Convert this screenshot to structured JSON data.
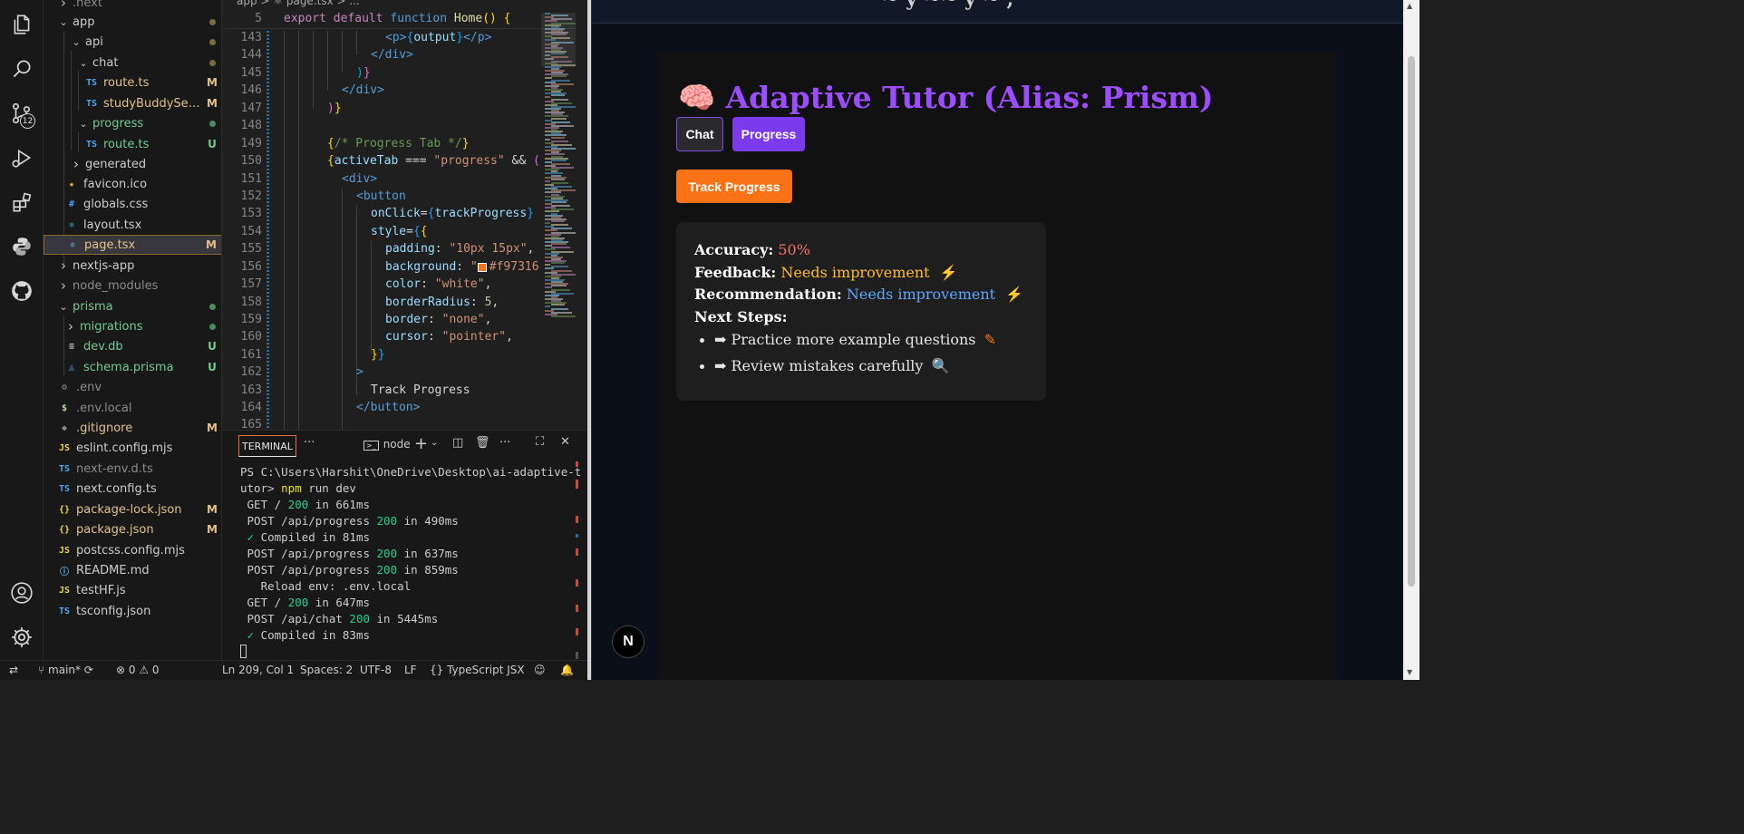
{
  "explorer": {
    "items": [
      {
        "label": ".next",
        "icon": "chevron-right-icon",
        "status": "",
        "color": "#8b8b8b"
      },
      {
        "label": "app",
        "icon": "chevron-down-icon",
        "status": "dot",
        "color": "#cccccc"
      },
      {
        "label": "api",
        "icon": "chevron-down-icon",
        "status": "dot",
        "color": "#cccccc"
      },
      {
        "label": "chat",
        "icon": "chevron-down-icon",
        "status": "dot",
        "color": "#cccccc"
      },
      {
        "label": "route.ts",
        "icon": "TS",
        "status": "M",
        "color": "#e2c08d"
      },
      {
        "label": "studyBuddyServ...",
        "icon": "TS",
        "status": "M",
        "color": "#e2c08d"
      },
      {
        "label": "progress",
        "icon": "chevron-down-icon",
        "status": "dot-green",
        "color": "#73c991"
      },
      {
        "label": "route.ts",
        "icon": "TS",
        "status": "U",
        "color": "#73c991"
      },
      {
        "label": "generated",
        "icon": "chevron-right-icon",
        "status": "",
        "color": "#cccccc"
      },
      {
        "label": "favicon.ico",
        "icon": "star",
        "status": "",
        "color": "#cccccc"
      },
      {
        "label": "globals.css",
        "icon": "#",
        "status": "",
        "color": "#cccccc"
      },
      {
        "label": "layout.tsx",
        "icon": "react",
        "status": "",
        "color": "#cccccc"
      },
      {
        "label": "page.tsx",
        "icon": "react",
        "status": "M",
        "color": "#e2c08d"
      },
      {
        "label": "nextjs-app",
        "icon": "chevron-right-icon",
        "status": "",
        "color": "#cccccc"
      },
      {
        "label": "node_modules",
        "icon": "chevron-right-icon",
        "status": "",
        "color": "#8b8b8b"
      },
      {
        "label": "prisma",
        "icon": "chevron-down-icon",
        "status": "dot-green",
        "color": "#73c991"
      },
      {
        "label": "migrations",
        "icon": "chevron-right-icon",
        "status": "dot-green",
        "color": "#73c991"
      },
      {
        "label": "dev.db",
        "icon": "db",
        "status": "U",
        "color": "#73c991"
      },
      {
        "label": "schema.prisma",
        "icon": "prisma",
        "status": "U",
        "color": "#73c991"
      },
      {
        "label": ".env",
        "icon": "gear",
        "status": "",
        "color": "#8b8b8b"
      },
      {
        "label": ".env.local",
        "icon": "$",
        "status": "",
        "color": "#8b8b8b"
      },
      {
        "label": ".gitignore",
        "icon": "git",
        "status": "M",
        "color": "#e2c08d"
      },
      {
        "label": "eslint.config.mjs",
        "icon": "JS",
        "status": "",
        "color": "#cccccc"
      },
      {
        "label": "next-env.d.ts",
        "icon": "TS",
        "status": "",
        "color": "#8b8b8b"
      },
      {
        "label": "next.config.ts",
        "icon": "TS",
        "status": "",
        "color": "#cccccc"
      },
      {
        "label": "package-lock.json",
        "icon": "{}",
        "status": "M",
        "color": "#e2c08d"
      },
      {
        "label": "package.json",
        "icon": "{}",
        "status": "M",
        "color": "#e2c08d"
      },
      {
        "label": "postcss.config.mjs",
        "icon": "JS",
        "status": "",
        "color": "#cccccc"
      },
      {
        "label": "README.md",
        "icon": "info",
        "status": "",
        "color": "#cccccc"
      },
      {
        "label": "testHF.js",
        "icon": "JS",
        "status": "",
        "color": "#cccccc"
      },
      {
        "label": "tsconfig.json",
        "icon": "TS",
        "status": "",
        "color": "#cccccc"
      }
    ]
  },
  "editor": {
    "breadcrumb": "app > ⚛ page.tsx > ...",
    "sticky_line_number": "5",
    "sticky_line": "export default function Home() {",
    "lines": [
      {
        "n": "143",
        "text": "<p>{output}</p>"
      },
      {
        "n": "144",
        "text": "</div>"
      },
      {
        "n": "145",
        "text": ")}"
      },
      {
        "n": "146",
        "text": "</div>"
      },
      {
        "n": "147",
        "text": ")}"
      },
      {
        "n": "148",
        "text": ""
      },
      {
        "n": "149",
        "text": "{/* Progress Tab */}"
      },
      {
        "n": "150",
        "text": "{activeTab === \"progress\" && ("
      },
      {
        "n": "151",
        "text": "<div>"
      },
      {
        "n": "152",
        "text": "<button"
      },
      {
        "n": "153",
        "text": "onClick={trackProgress}"
      },
      {
        "n": "154",
        "text": "style={{"
      },
      {
        "n": "155",
        "text": "padding: \"10px 15px\","
      },
      {
        "n": "156",
        "text": "background: \"#f97316"
      },
      {
        "n": "157",
        "text": "color: \"white\","
      },
      {
        "n": "158",
        "text": "borderRadius: 5,"
      },
      {
        "n": "159",
        "text": "border: \"none\","
      },
      {
        "n": "160",
        "text": "cursor: \"pointer\","
      },
      {
        "n": "161",
        "text": "}}"
      },
      {
        "n": "162",
        "text": ">"
      },
      {
        "n": "163",
        "text": "Track Progress"
      },
      {
        "n": "164",
        "text": "</button>"
      },
      {
        "n": "165",
        "text": ""
      }
    ]
  },
  "terminal": {
    "tab_label": "TERMINAL",
    "more": "···",
    "shell": "node",
    "lines": [
      "PS C:\\Users\\Harshit\\OneDrive\\Desktop\\ai-adaptive-t",
      "utor> npm run dev",
      " GET / 200 in 661ms",
      " POST /api/progress 200 in 490ms",
      " ✓ Compiled in 81ms",
      " POST /api/progress 200 in 637ms",
      " POST /api/progress 200 in 859ms",
      "   Reload env: .env.local",
      " GET / 200 in 647ms",
      " POST /api/chat 200 in 5445ms",
      " ✓ Compiled in 83ms"
    ]
  },
  "statusbar": {
    "branch": "main*",
    "problems": "⊗ 0 ⚠ 0",
    "position": "Ln 209, Col 1",
    "spaces": "Spaces: 2",
    "encoding": "UTF-8",
    "eol": "LF",
    "language": "{} TypeScript JSX"
  },
  "activity": {
    "source_control_count": "12"
  },
  "app": {
    "header_fragment": "~ y ~~ y ~ ,",
    "title": "🧠 Adaptive Tutor (Alias: Prism)",
    "tabs": [
      "Chat",
      "Progress"
    ],
    "track_button": "Track Progress",
    "accuracy_label": "Accuracy:",
    "accuracy_value": "50%",
    "feedback_label": "Feedback:",
    "feedback_value": "Needs improvement",
    "recommendation_label": "Recommendation:",
    "recommendation_value": "Needs improvement",
    "next_steps_label": "Next Steps:",
    "next_steps": [
      "➡ Practice more example questions",
      "➡ Review mistakes carefully"
    ],
    "next_badge": "N",
    "colors": {
      "accent": "#9b4dff",
      "progress_tab": "#7c3aed",
      "track_button": "#f97316",
      "accuracy": "#f87171",
      "feedback": "#fbbf24",
      "recommendation": "#60a5fa"
    }
  }
}
